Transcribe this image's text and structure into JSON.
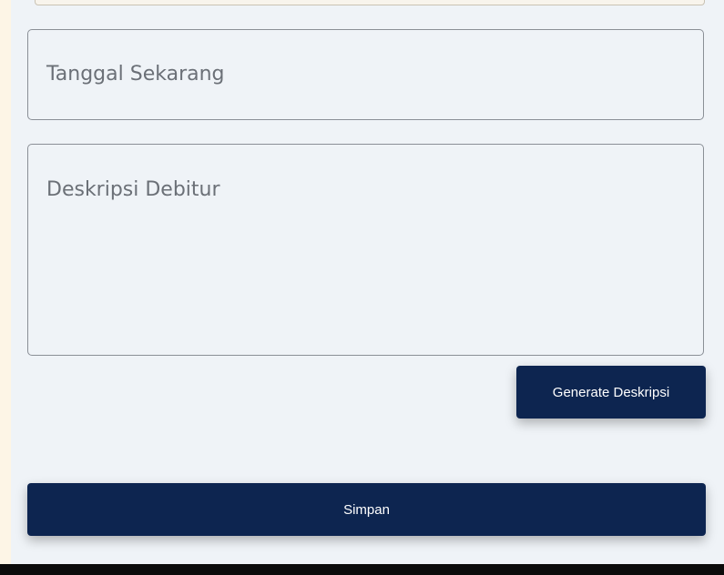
{
  "form": {
    "date_field": {
      "placeholder": "Tanggal Sekarang"
    },
    "description_field": {
      "placeholder": "Deskripsi Debitur"
    },
    "generate_button_label": "Generate Deskripsi",
    "save_button_label": "Simpan"
  },
  "colors": {
    "primary_button": "#0d2550",
    "panel_background": "#eff3f7",
    "page_background": "#fdf5e6"
  }
}
